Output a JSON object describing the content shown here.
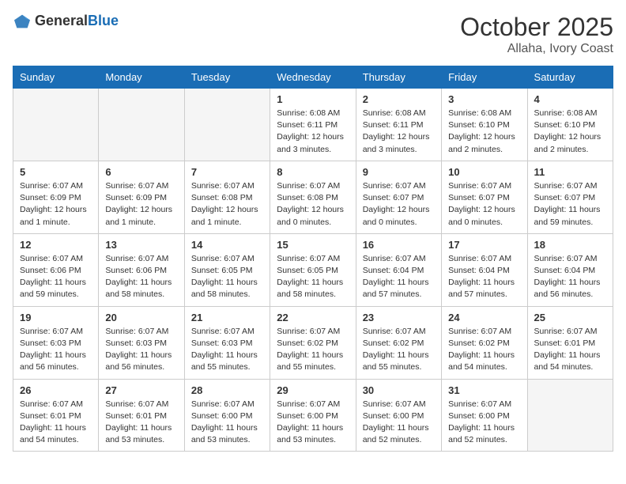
{
  "logo": {
    "general": "General",
    "blue": "Blue"
  },
  "header": {
    "month": "October 2025",
    "location": "Allaha, Ivory Coast"
  },
  "weekdays": [
    "Sunday",
    "Monday",
    "Tuesday",
    "Wednesday",
    "Thursday",
    "Friday",
    "Saturday"
  ],
  "weeks": [
    [
      {
        "day": "",
        "info": ""
      },
      {
        "day": "",
        "info": ""
      },
      {
        "day": "",
        "info": ""
      },
      {
        "day": "1",
        "info": "Sunrise: 6:08 AM\nSunset: 6:11 PM\nDaylight: 12 hours\nand 3 minutes."
      },
      {
        "day": "2",
        "info": "Sunrise: 6:08 AM\nSunset: 6:11 PM\nDaylight: 12 hours\nand 3 minutes."
      },
      {
        "day": "3",
        "info": "Sunrise: 6:08 AM\nSunset: 6:10 PM\nDaylight: 12 hours\nand 2 minutes."
      },
      {
        "day": "4",
        "info": "Sunrise: 6:08 AM\nSunset: 6:10 PM\nDaylight: 12 hours\nand 2 minutes."
      }
    ],
    [
      {
        "day": "5",
        "info": "Sunrise: 6:07 AM\nSunset: 6:09 PM\nDaylight: 12 hours\nand 1 minute."
      },
      {
        "day": "6",
        "info": "Sunrise: 6:07 AM\nSunset: 6:09 PM\nDaylight: 12 hours\nand 1 minute."
      },
      {
        "day": "7",
        "info": "Sunrise: 6:07 AM\nSunset: 6:08 PM\nDaylight: 12 hours\nand 1 minute."
      },
      {
        "day": "8",
        "info": "Sunrise: 6:07 AM\nSunset: 6:08 PM\nDaylight: 12 hours\nand 0 minutes."
      },
      {
        "day": "9",
        "info": "Sunrise: 6:07 AM\nSunset: 6:07 PM\nDaylight: 12 hours\nand 0 minutes."
      },
      {
        "day": "10",
        "info": "Sunrise: 6:07 AM\nSunset: 6:07 PM\nDaylight: 12 hours\nand 0 minutes."
      },
      {
        "day": "11",
        "info": "Sunrise: 6:07 AM\nSunset: 6:07 PM\nDaylight: 11 hours\nand 59 minutes."
      }
    ],
    [
      {
        "day": "12",
        "info": "Sunrise: 6:07 AM\nSunset: 6:06 PM\nDaylight: 11 hours\nand 59 minutes."
      },
      {
        "day": "13",
        "info": "Sunrise: 6:07 AM\nSunset: 6:06 PM\nDaylight: 11 hours\nand 58 minutes."
      },
      {
        "day": "14",
        "info": "Sunrise: 6:07 AM\nSunset: 6:05 PM\nDaylight: 11 hours\nand 58 minutes."
      },
      {
        "day": "15",
        "info": "Sunrise: 6:07 AM\nSunset: 6:05 PM\nDaylight: 11 hours\nand 58 minutes."
      },
      {
        "day": "16",
        "info": "Sunrise: 6:07 AM\nSunset: 6:04 PM\nDaylight: 11 hours\nand 57 minutes."
      },
      {
        "day": "17",
        "info": "Sunrise: 6:07 AM\nSunset: 6:04 PM\nDaylight: 11 hours\nand 57 minutes."
      },
      {
        "day": "18",
        "info": "Sunrise: 6:07 AM\nSunset: 6:04 PM\nDaylight: 11 hours\nand 56 minutes."
      }
    ],
    [
      {
        "day": "19",
        "info": "Sunrise: 6:07 AM\nSunset: 6:03 PM\nDaylight: 11 hours\nand 56 minutes."
      },
      {
        "day": "20",
        "info": "Sunrise: 6:07 AM\nSunset: 6:03 PM\nDaylight: 11 hours\nand 56 minutes."
      },
      {
        "day": "21",
        "info": "Sunrise: 6:07 AM\nSunset: 6:03 PM\nDaylight: 11 hours\nand 55 minutes."
      },
      {
        "day": "22",
        "info": "Sunrise: 6:07 AM\nSunset: 6:02 PM\nDaylight: 11 hours\nand 55 minutes."
      },
      {
        "day": "23",
        "info": "Sunrise: 6:07 AM\nSunset: 6:02 PM\nDaylight: 11 hours\nand 55 minutes."
      },
      {
        "day": "24",
        "info": "Sunrise: 6:07 AM\nSunset: 6:02 PM\nDaylight: 11 hours\nand 54 minutes."
      },
      {
        "day": "25",
        "info": "Sunrise: 6:07 AM\nSunset: 6:01 PM\nDaylight: 11 hours\nand 54 minutes."
      }
    ],
    [
      {
        "day": "26",
        "info": "Sunrise: 6:07 AM\nSunset: 6:01 PM\nDaylight: 11 hours\nand 54 minutes."
      },
      {
        "day": "27",
        "info": "Sunrise: 6:07 AM\nSunset: 6:01 PM\nDaylight: 11 hours\nand 53 minutes."
      },
      {
        "day": "28",
        "info": "Sunrise: 6:07 AM\nSunset: 6:00 PM\nDaylight: 11 hours\nand 53 minutes."
      },
      {
        "day": "29",
        "info": "Sunrise: 6:07 AM\nSunset: 6:00 PM\nDaylight: 11 hours\nand 53 minutes."
      },
      {
        "day": "30",
        "info": "Sunrise: 6:07 AM\nSunset: 6:00 PM\nDaylight: 11 hours\nand 52 minutes."
      },
      {
        "day": "31",
        "info": "Sunrise: 6:07 AM\nSunset: 6:00 PM\nDaylight: 11 hours\nand 52 minutes."
      },
      {
        "day": "",
        "info": ""
      }
    ]
  ]
}
